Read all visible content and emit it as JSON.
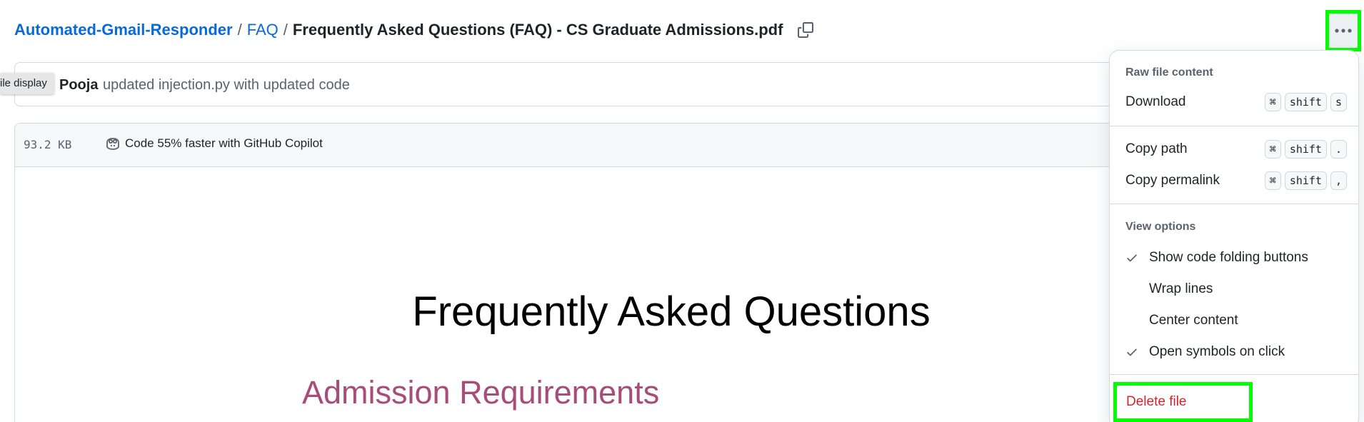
{
  "breadcrumb": {
    "repo": "Automated-Gmail-Responder",
    "folder": "FAQ",
    "separator": "/",
    "file": "Frequently Asked Questions (FAQ) - CS Graduate Admissions.pdf"
  },
  "tooltip": "ile display",
  "commit": {
    "author": "Pooja",
    "message": "updated injection.py with updated code"
  },
  "file_header": {
    "size": "93.2 KB",
    "copilot": "Code 55% faster with GitHub Copilot"
  },
  "document": {
    "title": "Frequently Asked Questions",
    "heading": "Admission Requirements"
  },
  "menu": {
    "raw_label": "Raw file content",
    "download": {
      "label": "Download",
      "keys": [
        "⌘",
        "shift",
        "s"
      ]
    },
    "copy_path": {
      "label": "Copy path",
      "keys": [
        "⌘",
        "shift",
        "."
      ]
    },
    "copy_permalink": {
      "label": "Copy permalink",
      "keys": [
        "⌘",
        "shift",
        ","
      ]
    },
    "view_label": "View options",
    "options": [
      {
        "label": "Show code folding buttons",
        "checked": true
      },
      {
        "label": "Wrap lines",
        "checked": false
      },
      {
        "label": "Center content",
        "checked": false
      },
      {
        "label": "Open symbols on click",
        "checked": true
      }
    ],
    "delete": "Delete file"
  },
  "colors": {
    "link": "#0969da",
    "danger": "#d1242f",
    "highlight": "#00ff00",
    "heading_accent": "#a64d79"
  }
}
